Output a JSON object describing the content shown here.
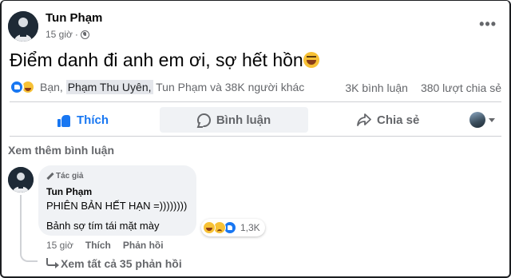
{
  "post": {
    "author": "Tun Phạm",
    "time": "15 giờ",
    "separator": "·",
    "more_label": "•••",
    "text": "Điểm danh đi anh em ơi, sợ hết hồn"
  },
  "reactions": {
    "names_prefix": "Bạn, ",
    "names_highlight": "Phạm Thu Uyên,",
    "names_suffix": " Tun Phạm và 38K người khác",
    "comments_count": "3K bình luận",
    "shares_count": "380 lượt chia sẻ"
  },
  "actions": {
    "like": "Thích",
    "comment": "Bình luận",
    "share": "Chia sẻ"
  },
  "see_more_comments": "Xem thêm bình luận",
  "comment": {
    "badge": "Tác giả",
    "author": "Tun Phạm",
    "line1": "PHIÊN BẢN HẾT HẠN =))))))))",
    "line2": "Bảnh sợ tím tái mặt mày",
    "reaction_count": "1,3K",
    "time": "15 giờ",
    "like": "Thích",
    "reply": "Phản hồi"
  },
  "view_replies": "Xem tất cả 35 phản hồi",
  "colors": {
    "accent": "#1877f2",
    "muted": "#65676b",
    "bubble": "#f0f2f5"
  }
}
